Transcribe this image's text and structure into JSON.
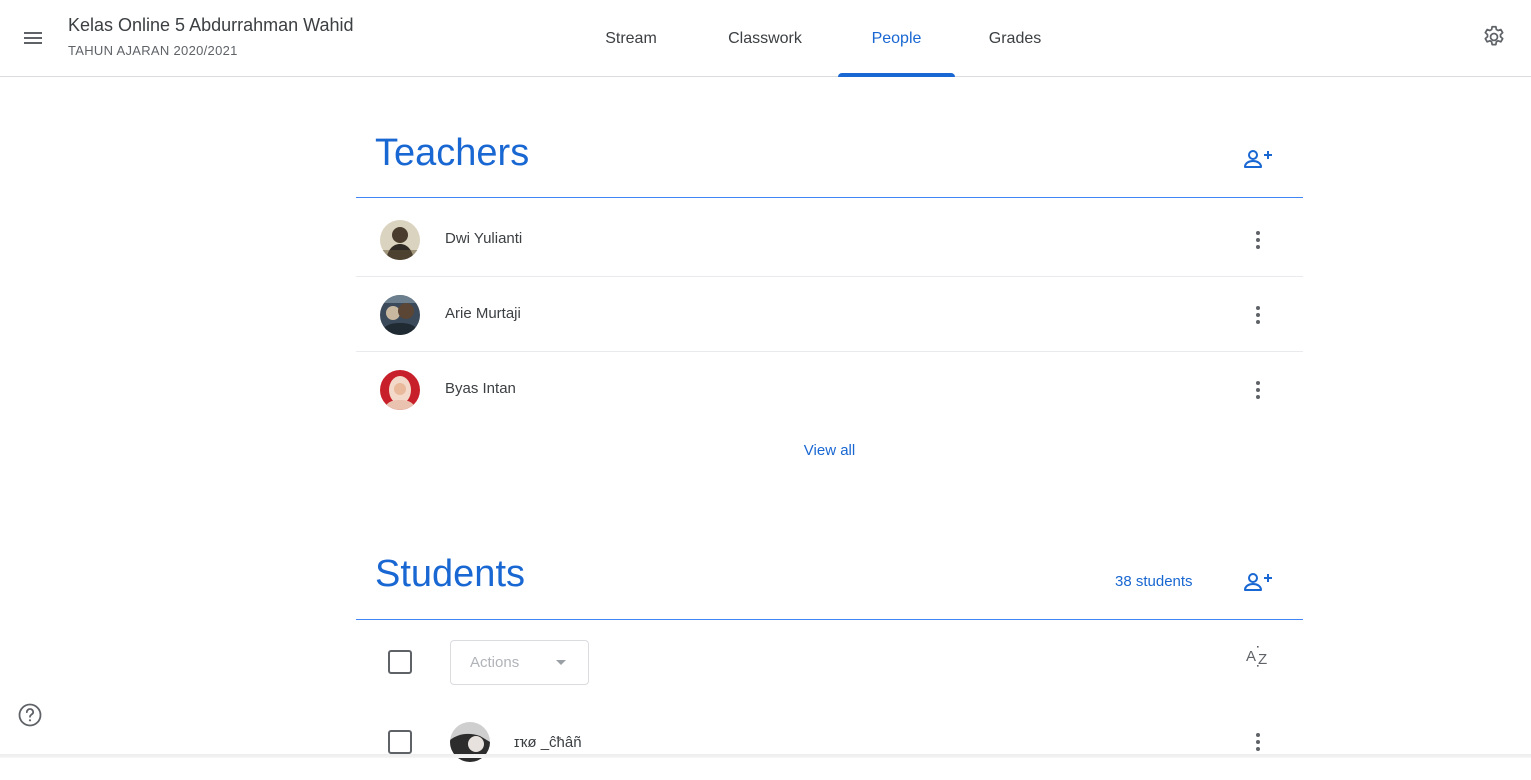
{
  "header": {
    "class_title": "Kelas Online 5 Abdurrahman Wahid",
    "class_subtitle": "TAHUN AJARAN 2020/2021",
    "tabs": [
      {
        "label": "Stream",
        "active": false
      },
      {
        "label": "Classwork",
        "active": false
      },
      {
        "label": "People",
        "active": true
      },
      {
        "label": "Grades",
        "active": false
      }
    ]
  },
  "teachers": {
    "title": "Teachers",
    "items": [
      {
        "name": "Dwi Yulianti"
      },
      {
        "name": "Arie Murtaji"
      },
      {
        "name": "Byas Intan"
      }
    ],
    "view_all_label": "View all"
  },
  "students": {
    "title": "Students",
    "count_label": "38 students",
    "actions_label": "Actions",
    "sort_label": "AZ",
    "items": [
      {
        "name": "ɪҡø _ĉħâñ"
      }
    ]
  },
  "icons": {
    "menu": "menu-icon",
    "settings": "gear-icon",
    "add_person": "person-add-icon",
    "more": "more-vert-icon",
    "sort": "sort-az-icon",
    "help": "help-icon",
    "dropdown": "caret-down-icon"
  },
  "colors": {
    "accent": "#1967d2",
    "divider_accent": "#4285f4",
    "text_primary": "#3c4043",
    "text_secondary": "#5f6368"
  }
}
